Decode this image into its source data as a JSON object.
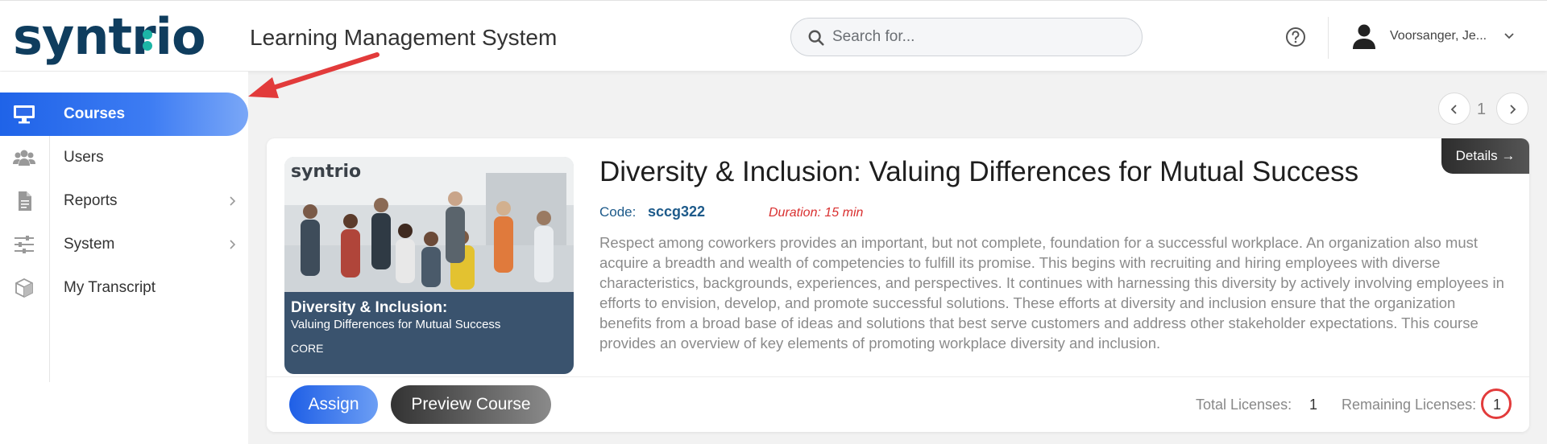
{
  "brand": {
    "logo_text_a": "syntr",
    "logo_text_b": "i",
    "logo_text_c": "o",
    "accent_color": "#1cb5a6",
    "primary_color": "#0f3d5e"
  },
  "header": {
    "title": "Learning Management System",
    "search_placeholder": "Search for...",
    "help_icon": "help-circle-icon",
    "user_name": "Voorsanger, Je...",
    "user_menu_icon": "chevron-down-icon"
  },
  "sidebar": {
    "items": [
      {
        "label": "Courses",
        "icon": "monitor-icon",
        "active": true,
        "has_submenu": false
      },
      {
        "label": "Users",
        "icon": "users-icon",
        "active": false,
        "has_submenu": false
      },
      {
        "label": "Reports",
        "icon": "document-icon",
        "active": false,
        "has_submenu": true
      },
      {
        "label": "System",
        "icon": "sliders-icon",
        "active": false,
        "has_submenu": true
      },
      {
        "label": "My Transcript",
        "icon": "cube-icon",
        "active": false,
        "has_submenu": false
      }
    ],
    "active_color": "#1f63e8"
  },
  "pagination": {
    "current_page": "1"
  },
  "course": {
    "details_label": "Details →",
    "title": "Diversity & Inclusion: Valuing Differences for Mutual Success",
    "code_label": "Code:",
    "code_value": "sccg322",
    "duration": "Duration: 15 min",
    "description": "Respect among coworkers provides an important, but not complete, foundation for a successful workplace. An organization also must acquire a breadth and wealth of competencies to fulfill its promise. This begins with recruiting and hiring employees with diverse characteristics, backgrounds, experiences, and perspectives. It continues with harnessing this diversity by actively involving employees in efforts to envision, develop, and promote successful solutions. These efforts at diversity and inclusion ensure that the organization benefits from a broad base of ideas and solutions that best serve customers and address other stakeholder expectations. This course provides an overview of key elements of promoting workplace diversity and inclusion.",
    "thumbnail": {
      "brand": "syntrio",
      "title": "Diversity & Inclusion:",
      "subtitle": "Valuing Differences for Mutual Success",
      "tag": "CORE"
    },
    "assign_label": "Assign",
    "preview_label": "Preview Course",
    "total_licenses_label": "Total Licenses:",
    "total_licenses_value": "1",
    "remaining_licenses_label": "Remaining Licenses:",
    "remaining_licenses_value": "1"
  },
  "annotation_color": "#e23b3b"
}
